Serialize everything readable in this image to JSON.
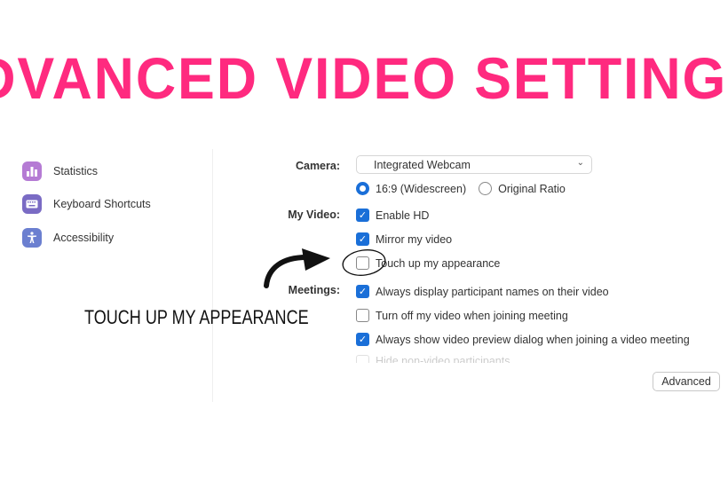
{
  "headline": "ADVANCED VIDEO SETTINGS",
  "colors": {
    "headline": "#ff2a7f",
    "accent": "#1a6fd8",
    "statistics_icon": "#b57bd4",
    "keyboard_icon": "#7a6bc4",
    "accessibility_icon": "#6b7fd0"
  },
  "sidebar": {
    "items": [
      {
        "label": "Statistics",
        "icon": "bar-chart-icon"
      },
      {
        "label": "Keyboard Shortcuts",
        "icon": "keyboard-icon"
      },
      {
        "label": "Accessibility",
        "icon": "accessibility-icon"
      }
    ]
  },
  "settings": {
    "camera": {
      "label": "Camera:",
      "selected": "Integrated Webcam",
      "ratio_options": [
        {
          "label": "16:9 (Widescreen)",
          "selected": true
        },
        {
          "label": "Original Ratio",
          "selected": false
        }
      ]
    },
    "my_video": {
      "label": "My Video:",
      "options": [
        {
          "label": "Enable HD",
          "checked": true
        },
        {
          "label": "Mirror my video",
          "checked": true
        },
        {
          "label": "Touch up my appearance",
          "checked": false
        }
      ]
    },
    "meetings": {
      "label": "Meetings:",
      "options": [
        {
          "label": "Always display participant names on their video",
          "checked": true
        },
        {
          "label": "Turn off my video when joining meeting",
          "checked": false
        },
        {
          "label": "Always show video preview dialog when joining a video meeting",
          "checked": true
        },
        {
          "label": "Hide non-video participants",
          "checked": false
        }
      ]
    },
    "advanced_button": "Advanced"
  },
  "annotation": {
    "text": "TOUCH UP MY APPEARANCE"
  }
}
